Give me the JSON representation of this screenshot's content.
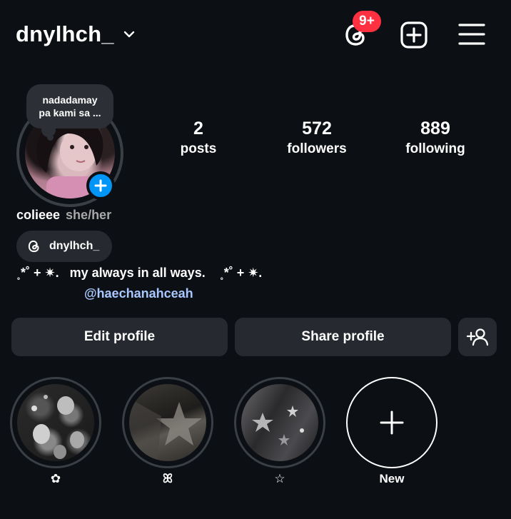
{
  "header": {
    "username": "dnylhch_",
    "notification_badge": "9+",
    "icons": {
      "threads": "threads-icon",
      "create": "plus-square-icon",
      "menu": "hamburger-menu-icon"
    }
  },
  "profile": {
    "note": {
      "line1": "nadadamay",
      "line2": "pa kami sa ..."
    },
    "stats": {
      "posts": {
        "count": "2",
        "label": "posts"
      },
      "followers": {
        "count": "572",
        "label": "followers"
      },
      "following": {
        "count": "889",
        "label": "following"
      }
    },
    "display_name": "colieee",
    "pronouns": "she/her",
    "threads_handle": "dnylhch_",
    "bio_line": "˳*˚ + ✷.   my always in all ways.    ˳*˚ + ✷.",
    "mention": "@haechanahceah"
  },
  "actions": {
    "edit_label": "Edit profile",
    "share_label": "Share profile",
    "discover_icon": "add-person-icon"
  },
  "highlights": [
    {
      "label": "✿"
    },
    {
      "label": "ꕤ"
    },
    {
      "label": "☆"
    },
    {
      "label": "New"
    }
  ],
  "colors": {
    "background": "#0c0f14",
    "button": "#262a30",
    "badge": "#ff3040",
    "accent_blue": "#0095f6",
    "mention": "#a9c8ff"
  }
}
